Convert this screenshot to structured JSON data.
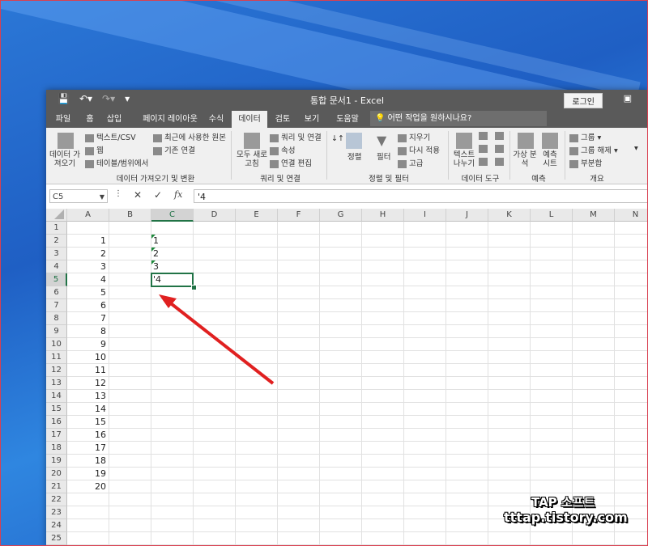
{
  "window": {
    "title": "통합 문서1 - Excel",
    "login_label": "로그인",
    "tell_me_placeholder": "어떤 작업을 원하시나요?"
  },
  "tabs": [
    "파일",
    "홈",
    "삽입",
    "페이지 레이아웃",
    "수식",
    "데이터",
    "검토",
    "보기",
    "도움말"
  ],
  "active_tab": "데이터",
  "ribbon": {
    "get_data": "데이터 가져오기",
    "text_csv": "텍스트/CSV",
    "web": "웹",
    "table_range": "테이블/범위에서",
    "recent_sources": "최근에 사용한 원본",
    "existing_connections": "기존 연결",
    "group_get_transform": "데이터 가져오기 및 변환",
    "refresh_all": "모두 새로 고침",
    "queries_connections": "쿼리 및 연결",
    "properties": "속성",
    "edit_links": "연결 편집",
    "group_queries": "쿼리 및 연결",
    "sort": "정렬",
    "filter": "필터",
    "clear": "지우기",
    "reapply": "다시 적용",
    "advanced": "고급",
    "group_sort_filter": "정렬 및 필터",
    "text_to_columns": "텍스트 나누기",
    "group_data_tools": "데이터 도구",
    "what_if": "가상 분석",
    "forecast_sheet": "예측 시트",
    "group_forecast": "예측",
    "group_btn": "그룹",
    "ungroup_btn": "그룹 해제",
    "subtotal": "부분합",
    "group_outline": "개요"
  },
  "formula_bar": {
    "name_box": "C5",
    "cancel": "✕",
    "enter": "✓",
    "fx": "fx",
    "formula": "'4"
  },
  "columns": [
    "A",
    "B",
    "C",
    "D",
    "E",
    "F",
    "G",
    "H",
    "I",
    "J",
    "K",
    "L",
    "M",
    "N"
  ],
  "selected_column": "C",
  "rows": [
    "1",
    "2",
    "3",
    "4",
    "5",
    "6",
    "7",
    "8",
    "9",
    "10",
    "11",
    "12",
    "13",
    "14",
    "15",
    "16",
    "17",
    "18",
    "19",
    "20",
    "21",
    "22",
    "23",
    "24",
    "25"
  ],
  "selected_row": "5",
  "column_a_values": [
    "",
    "1",
    "2",
    "3",
    "4",
    "5",
    "6",
    "7",
    "8",
    "9",
    "10",
    "11",
    "12",
    "13",
    "14",
    "15",
    "16",
    "17",
    "18",
    "19",
    "20"
  ],
  "column_c_values": [
    "",
    "1",
    "2",
    "3",
    "'4"
  ],
  "watermark": {
    "line1": "TAP 소프트",
    "line2": "tttap.tistory.com"
  },
  "colors": {
    "excel_green": "#217346",
    "arrow_red": "#e02020",
    "titlebar_gray": "#5a5a5a"
  }
}
